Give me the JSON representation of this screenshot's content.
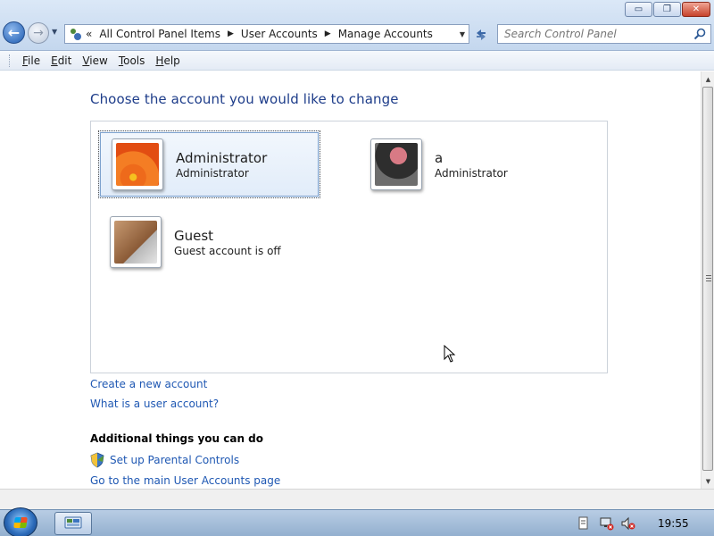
{
  "window": {
    "minimize_glyph": "▭",
    "maximize_glyph": "❐",
    "close_glyph": "✕"
  },
  "address_bar": {
    "overflow": "«",
    "crumbs": [
      "All Control Panel Items",
      "User Accounts",
      "Manage Accounts"
    ],
    "separator": "▶"
  },
  "search": {
    "placeholder": "Search Control Panel"
  },
  "menu": {
    "file": {
      "key": "F",
      "rest": "ile"
    },
    "edit": {
      "key": "E",
      "rest": "dit"
    },
    "view": {
      "key": "V",
      "rest": "iew"
    },
    "tools": {
      "key": "T",
      "rest": "ools"
    },
    "help": {
      "key": "H",
      "rest": "elp"
    }
  },
  "main": {
    "heading": "Choose the account you would like to change",
    "accounts": [
      {
        "name": "Administrator",
        "type": "Administrator",
        "picture": "flower",
        "selected": true
      },
      {
        "name": "a",
        "type": "Administrator",
        "picture": "record-player",
        "selected": false
      },
      {
        "name": "Guest",
        "type": "Guest account is off",
        "picture": "briefcase",
        "selected": false
      }
    ],
    "links": {
      "create_account": "Create a new account",
      "what_is_account": "What is a user account?"
    },
    "additional": {
      "title": "Additional things you can do",
      "parental_controls": "Set up Parental Controls",
      "main_page": "Go to the main User Accounts page"
    }
  },
  "taskbar": {
    "clock": "19:55"
  },
  "colors": {
    "link": "#1f58b3",
    "heading": "#1e3d8a"
  }
}
